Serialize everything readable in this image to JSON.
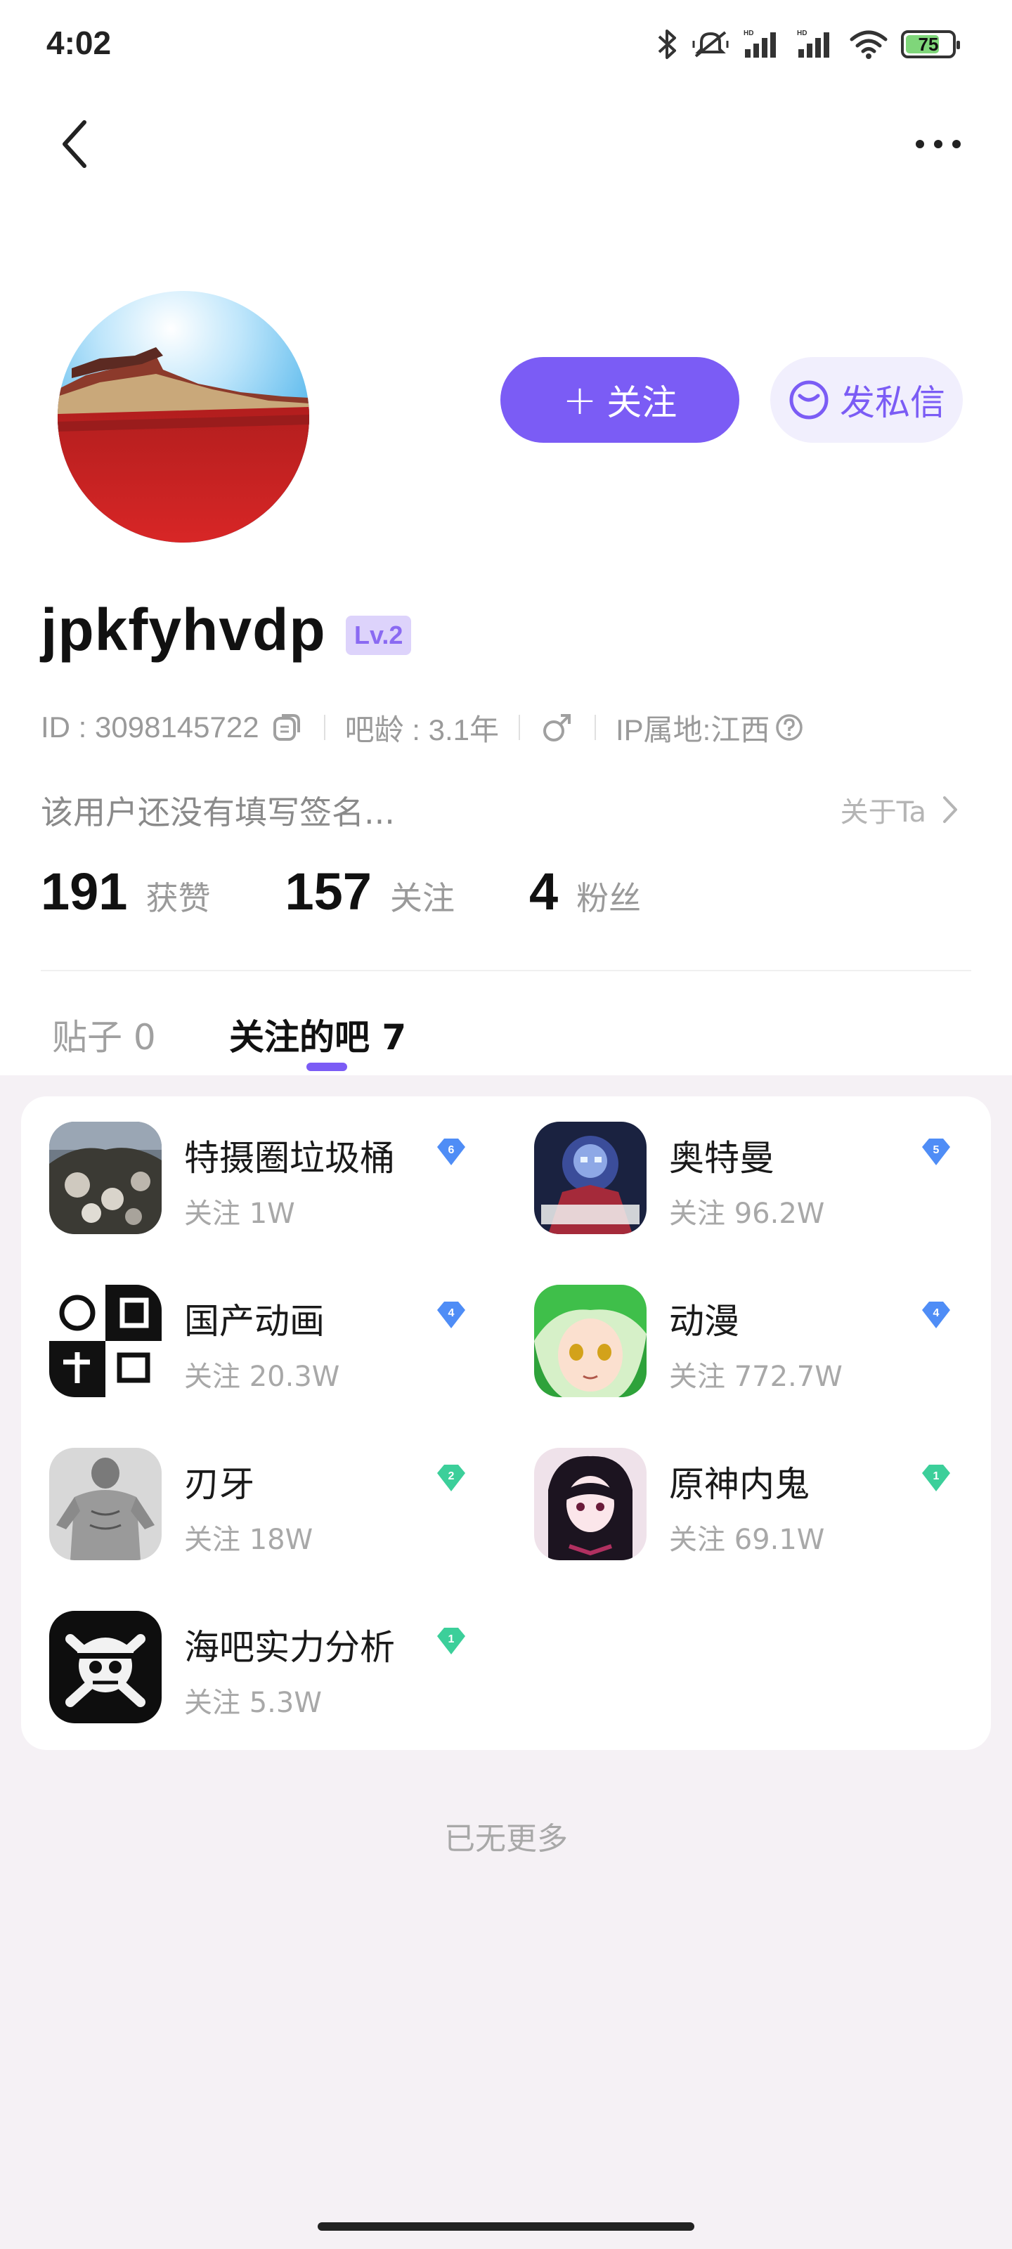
{
  "status_bar": {
    "time": "4:02",
    "battery": "75",
    "battery_level": 0.75,
    "icons": [
      "bluetooth-icon",
      "mute-vibrate-icon",
      "signal-hd-icon",
      "signal-hd-icon",
      "wifi-icon",
      "battery-icon"
    ]
  },
  "nav": {
    "back_icon": "chevron-left-icon",
    "more_icon": "more-horizontal-icon"
  },
  "profile": {
    "username": "jpkfyhvdp",
    "level": "Lv.2",
    "id_text": "ID : 3098145722",
    "age_text": "吧龄 : 3.1年",
    "gender": "male-icon",
    "ip_text": "IP属地:江西",
    "signature": "该用户还没有填写签名...",
    "about_label": "关于Ta"
  },
  "actions": {
    "follow_label": "关注",
    "follow_plus": "+",
    "message_label": "发私信"
  },
  "stats": [
    {
      "num": "191",
      "label": "获赞"
    },
    {
      "num": "157",
      "label": "关注"
    },
    {
      "num": "4",
      "label": "粉丝"
    }
  ],
  "tabs": [
    {
      "label": "贴子 0",
      "active": false
    },
    {
      "label": "关注的吧 7",
      "active": true
    }
  ],
  "bars": [
    {
      "name": "特摄圈垃圾桶",
      "follow": "关注 1W",
      "level": "6",
      "level_color": "#4f8df6"
    },
    {
      "name": "奥特曼",
      "follow": "关注 96.2W",
      "level": "5",
      "level_color": "#4f8df6"
    },
    {
      "name": "国产动画",
      "follow": "关注 20.3W",
      "level": "4",
      "level_color": "#4f8df6"
    },
    {
      "name": "动漫",
      "follow": "关注 772.7W",
      "level": "4",
      "level_color": "#4f8df6"
    },
    {
      "name": "刃牙",
      "follow": "关注 18W",
      "level": "2",
      "level_color": "#3ccf9a"
    },
    {
      "name": "原神内鬼",
      "follow": "关注 69.1W",
      "level": "1",
      "level_color": "#3ccf9a"
    },
    {
      "name": "海吧实力分析",
      "follow": "关注 5.3W",
      "level": "1",
      "level_color": "#3ccf9a"
    }
  ],
  "footer": {
    "no_more": "已无更多"
  },
  "colors": {
    "accent": "#7b5cf5",
    "accent_light": "#f1effd",
    "page_bg": "#f5f1f5"
  }
}
